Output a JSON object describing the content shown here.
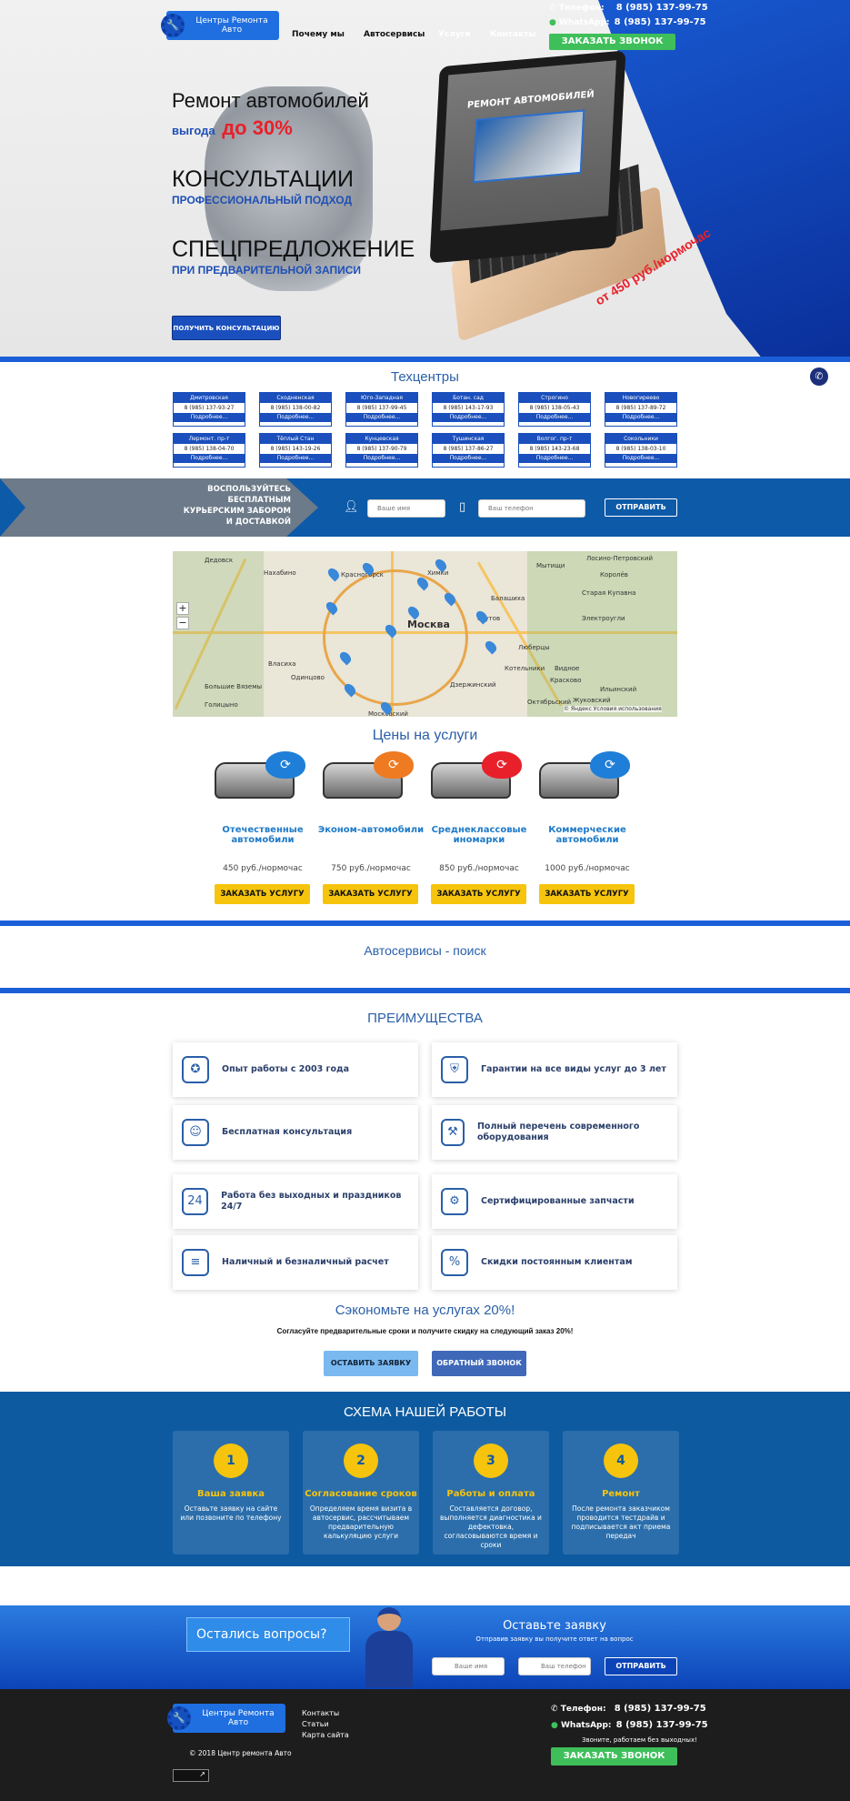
{
  "header": {
    "logo_line1": "Центры Ремонта",
    "logo_line2": "Авто",
    "nav": [
      "Почему мы",
      "Автосервисы",
      "Услуги",
      "Контакты"
    ],
    "phone_label": "Телефон:",
    "phone": "8 (985) 137-99-75",
    "whatsapp_label": "WhatsApp:",
    "whatsapp": "8 (985) 137-99-75",
    "callback_button": "ЗАКАЗАТЬ ЗВОНОК"
  },
  "hero": {
    "line1": "Ремонт автомобилей",
    "line2_prefix": "выгода",
    "line2_value": "до 30%",
    "line3": "КОНСУЛЬТАЦИИ",
    "line4": "ПРОФЕССИОНАЛЬНЫЙ ПОДХОД",
    "line5": "СПЕЦПРЕДЛОЖЕНИЕ",
    "line6": "ПРИ ПРЕДВАРИТЕЛЬНОЙ ЗАПИСИ",
    "consult_button": "ПОЛУЧИТЬ КОНСУЛЬТАЦИЮ",
    "screen_title": "РЕМОНТ АВТОМОБИЛЕЙ",
    "price_tag": "от 450 руб./нормочас"
  },
  "centers": {
    "title": "Техцентры",
    "more": "Подробнее...",
    "items": [
      {
        "name": "Дмитровская",
        "phone": "8 (985) 137-93-27"
      },
      {
        "name": "Сходненская",
        "phone": "8 (985) 138-00-82"
      },
      {
        "name": "Юго-Западная",
        "phone": "8 (985) 137-99-45"
      },
      {
        "name": "Ботан. сад",
        "phone": "8 (985) 143-17-93"
      },
      {
        "name": "Строгино",
        "phone": "8 (985) 138-05-43"
      },
      {
        "name": "Новогиреево",
        "phone": "8 (985) 137-89-72"
      },
      {
        "name": "Лермонт. пр-т",
        "phone": "8 (985) 138-04-70"
      },
      {
        "name": "Тёплый Стан",
        "phone": "8 (985) 143-19-26"
      },
      {
        "name": "Кунцевская",
        "phone": "8 (985) 137-90-79"
      },
      {
        "name": "Тушинская",
        "phone": "8 (985) 137-86-27"
      },
      {
        "name": "Волгог. пр-т",
        "phone": "8 (985) 143-23-68"
      },
      {
        "name": "Сокольники",
        "phone": "8 (985) 138-03-10"
      }
    ]
  },
  "courier": {
    "text": "ВОСПОЛЬЗУЙТЕСЬ БЕСПЛАТНЫМ КУРЬЕРСКИМ ЗАБОРОМ И ДОСТАВКОЙ",
    "name_placeholder": "Ваше имя",
    "phone_placeholder": "Ваш телефон",
    "send_button": "ОТПРАВИТЬ"
  },
  "map": {
    "city": "Москва",
    "labels": [
      "Дедовск",
      "Нахабино",
      "Красногорск",
      "Химки",
      "Мытищи",
      "Лосино-Петровский",
      "Королёв",
      "Балашиха",
      "Старая Купавна",
      "Реутов",
      "Электроугли",
      "Люберцы",
      "Котельники",
      "Дзержинский",
      "Видное",
      "Власиха",
      "Одинцово",
      "Большие Вяземы",
      "Голицыно",
      "Московский",
      "Жуковский",
      "Октябрьский",
      "Красково",
      "Ильинский"
    ],
    "zoom_in": "+",
    "zoom_out": "−",
    "attribution": "© Яндекс Условия использования"
  },
  "prices": {
    "title": "Цены на услуги",
    "order_button": "ЗАКАЗАТЬ УСЛУГУ",
    "items": [
      {
        "title": "Отечественные автомобили",
        "price": "450 руб./нормочас"
      },
      {
        "title": "Эконом-автомобили",
        "price": "750 руб./нормочас"
      },
      {
        "title": "Среднеклассовые иномарки",
        "price": "850 руб./нормочас"
      },
      {
        "title": "Коммерческие автомобили",
        "price": "1000 руб./нормочас"
      }
    ]
  },
  "search": {
    "title": "Автосервисы - поиск"
  },
  "advantages": {
    "title": "ПРЕИМУЩЕСТВА",
    "items": [
      {
        "icon": "award-icon",
        "text": "Опыт работы с 2003 года"
      },
      {
        "icon": "shield-icon",
        "text": "Гарантии на все виды услуг до 3 лет"
      },
      {
        "icon": "worker-icon",
        "text": "Бесплатная консультация"
      },
      {
        "icon": "tools-icon",
        "text": "Полный перечень современного оборудования"
      },
      {
        "icon": "clock24-icon",
        "text": "Работа без выходных и праздников 24/7"
      },
      {
        "icon": "parts-icon",
        "text": "Сертифицированные запчасти"
      },
      {
        "icon": "money-icon",
        "text": "Наличный и безналичный расчет"
      },
      {
        "icon": "discount-icon",
        "text": "Скидки постоянным клиентам"
      }
    ]
  },
  "save": {
    "title": "Сэкономьте на услугах 20%!",
    "text": "Согласуйте предварительные сроки и получите скидку на следующий заказ 20%!",
    "request_button": "ОСТАВИТЬ ЗАЯВКУ",
    "callback_button": "ОБРАТНЫЙ ЗВОНОК"
  },
  "scheme": {
    "title": "СХЕМА НАШЕЙ РАБОТЫ",
    "steps": [
      {
        "n": "1",
        "title": "Ваша заявка",
        "text": "Оставьте заявку на сайте или позвоните по телефону"
      },
      {
        "n": "2",
        "title": "Согласование сроков",
        "text": "Определяем время визита в автосервис, рассчитываем предварительную калькуляцию услуги"
      },
      {
        "n": "3",
        "title": "Работы и оплата",
        "text": "Составляется договор, выполняется диагностика и дефектовка, согласовываются время и сроки"
      },
      {
        "n": "4",
        "title": "Ремонт",
        "text": "После ремонта заказчиком проводится тестдрайв и подписывается акт приема передач"
      }
    ]
  },
  "questions": {
    "bubble": "Остались вопросы?",
    "title": "Оставьте заявку",
    "subtitle": "Отправив заявку вы получите ответ на вопрос",
    "name_placeholder": "Ваше имя",
    "phone_placeholder": "Ваш телефон",
    "send_button": "ОТПРАВИТЬ"
  },
  "footer": {
    "links": [
      "Контакты",
      "Статьи",
      "Карта сайта"
    ],
    "copyright": "© 2018 Центр ремонта Авто",
    "phone_label": "Телефон:",
    "phone": "8 (985) 137-99-75",
    "whatsapp_label": "WhatsApp:",
    "whatsapp": "8 (985) 137-99-75",
    "hours": "Звоните, работаем без выходных!",
    "callback_button": "ЗАКАЗАТЬ ЗВОНОК"
  },
  "colors": {
    "brand_blue": "#1a5fd8",
    "accent_yellow": "#f6c40c",
    "accent_green": "#3fbf5a",
    "accent_red": "#e8202a"
  }
}
